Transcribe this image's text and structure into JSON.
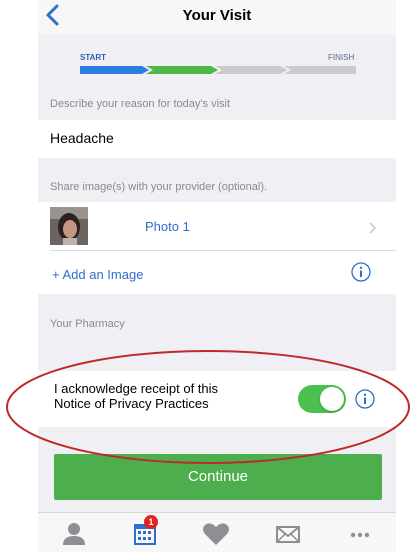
{
  "nav": {
    "title": "Your Visit"
  },
  "progress": {
    "start_label": "START",
    "finish_label": "FINISH",
    "steps_total": 4,
    "steps_completed": 2,
    "colors": {
      "done_blue": "#2f7de1",
      "done_green": "#4cb848",
      "pending": "#c9c9ce"
    }
  },
  "reason": {
    "label": "Describe your reason for today's visit",
    "value": "Headache"
  },
  "images": {
    "label": "Share image(s) with your provider (optional).",
    "items": [
      {
        "label": "Photo 1"
      }
    ],
    "add_label": "+ Add an Image"
  },
  "pharmacy": {
    "label": "Your Pharmacy"
  },
  "privacy": {
    "line1": "I acknowledge receipt of this",
    "line2": "Notice of Privacy Practices",
    "toggle_on": true
  },
  "continue": {
    "label": "Continue"
  },
  "tabbar": {
    "tabs": [
      {
        "icon": "person-icon"
      },
      {
        "icon": "calendar-icon",
        "badge": "1"
      },
      {
        "icon": "heart-icon"
      },
      {
        "icon": "mail-icon"
      },
      {
        "icon": "more-icon"
      }
    ]
  },
  "colors": {
    "accent_blue": "#2f6ecb",
    "green": "#4cae4c",
    "annotation_red": "#c0282b"
  }
}
